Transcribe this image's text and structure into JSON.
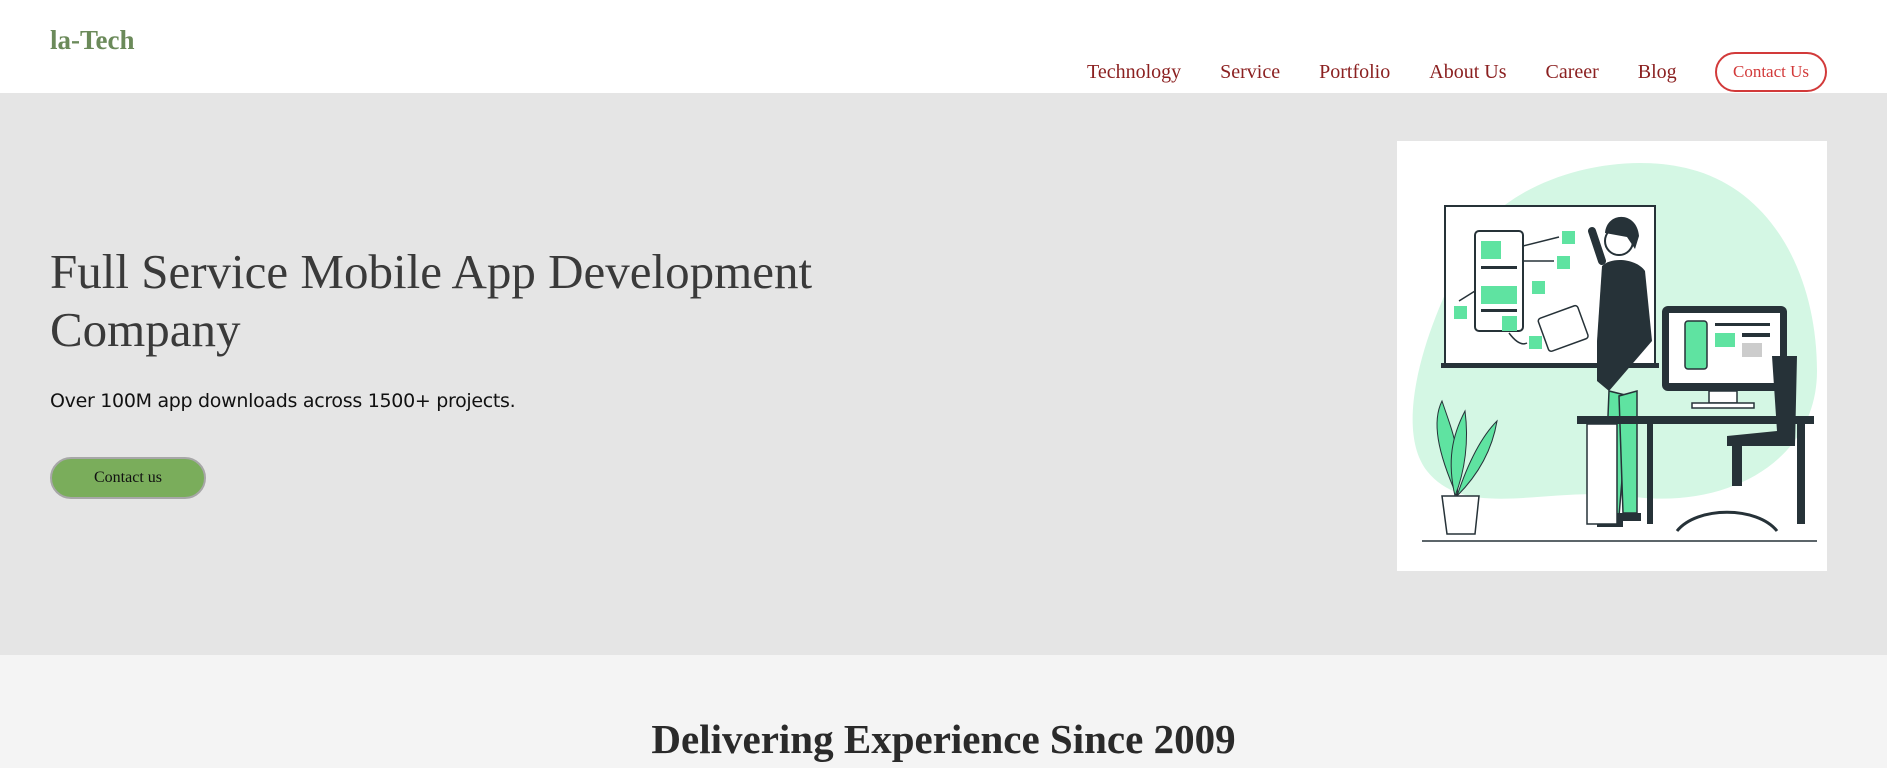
{
  "brand": {
    "logo": "la-Tech"
  },
  "nav": {
    "items": [
      {
        "label": "Technology"
      },
      {
        "label": "Service"
      },
      {
        "label": "Portfolio"
      },
      {
        "label": "About Us"
      },
      {
        "label": "Career"
      },
      {
        "label": "Blog"
      }
    ],
    "contact_label": "Contact Us"
  },
  "hero": {
    "title": "Full Service Mobile App Development Company",
    "subtitle": "Over 100M app downloads across 1500+ projects.",
    "cta_label": "Contact us",
    "illustration": "developer-at-whiteboard-illustration"
  },
  "section2": {
    "title": "Delivering Experience Since 2009"
  },
  "colors": {
    "logo": "#6b8a5a",
    "nav_link": "#8b2020",
    "contact_border": "#d23a3a",
    "hero_bg": "#e5e5e5",
    "cta_bg": "#7aad5b",
    "illustration_accent": "#5fe3a1"
  }
}
